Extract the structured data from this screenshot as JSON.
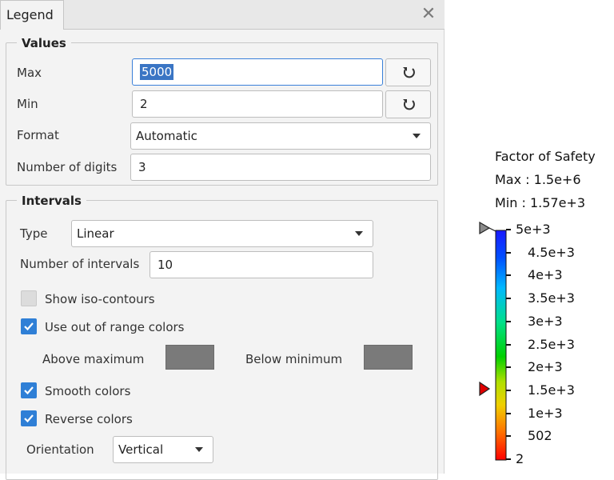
{
  "tab": {
    "label": "Legend",
    "close_glyph": "✕"
  },
  "values_group": {
    "title": "Values",
    "max_label": "Max",
    "max_value": "5000",
    "min_label": "Min",
    "min_value": "2",
    "format_label": "Format",
    "format_value": "Automatic",
    "digits_label": "Number of digits",
    "digits_value": "3",
    "reset_icon": "reset-icon"
  },
  "intervals_group": {
    "title": "Intervals",
    "type_label": "Type",
    "type_value": "Linear",
    "num_intervals_label": "Number of intervals",
    "num_intervals_value": "10",
    "show_iso_label": "Show iso-contours",
    "show_iso_checked": false,
    "out_of_range_label": "Use out of range colors",
    "out_of_range_checked": true,
    "above_max_label": "Above maximum",
    "below_min_label": "Below minimum",
    "above_color": "#7a7a7a",
    "below_color": "#7a7a7a",
    "smooth_label": "Smooth colors",
    "smooth_checked": true,
    "reverse_label": "Reverse colors",
    "reverse_checked": true,
    "orientation_label": "Orientation",
    "orientation_value": "Vertical"
  },
  "color_legend": {
    "title": "Factor of Safety",
    "max_text": "Max : 1.5e+6",
    "min_text": "Min : 1.57e+3",
    "ticks": [
      "5e+3",
      "4.5e+3",
      "4e+3",
      "3.5e+3",
      "3e+3",
      "2.5e+3",
      "2e+3",
      "1.5e+3",
      "1e+3",
      "502",
      "2"
    ],
    "colors": [
      "#1a1aff",
      "#0050ff",
      "#00b8ff",
      "#00e08a",
      "#00d000",
      "#b0e000",
      "#f0d000",
      "#ff7000",
      "#ff0000"
    ],
    "max_marker_color": "#8a8a8a",
    "min_marker_color": "#e00000"
  }
}
